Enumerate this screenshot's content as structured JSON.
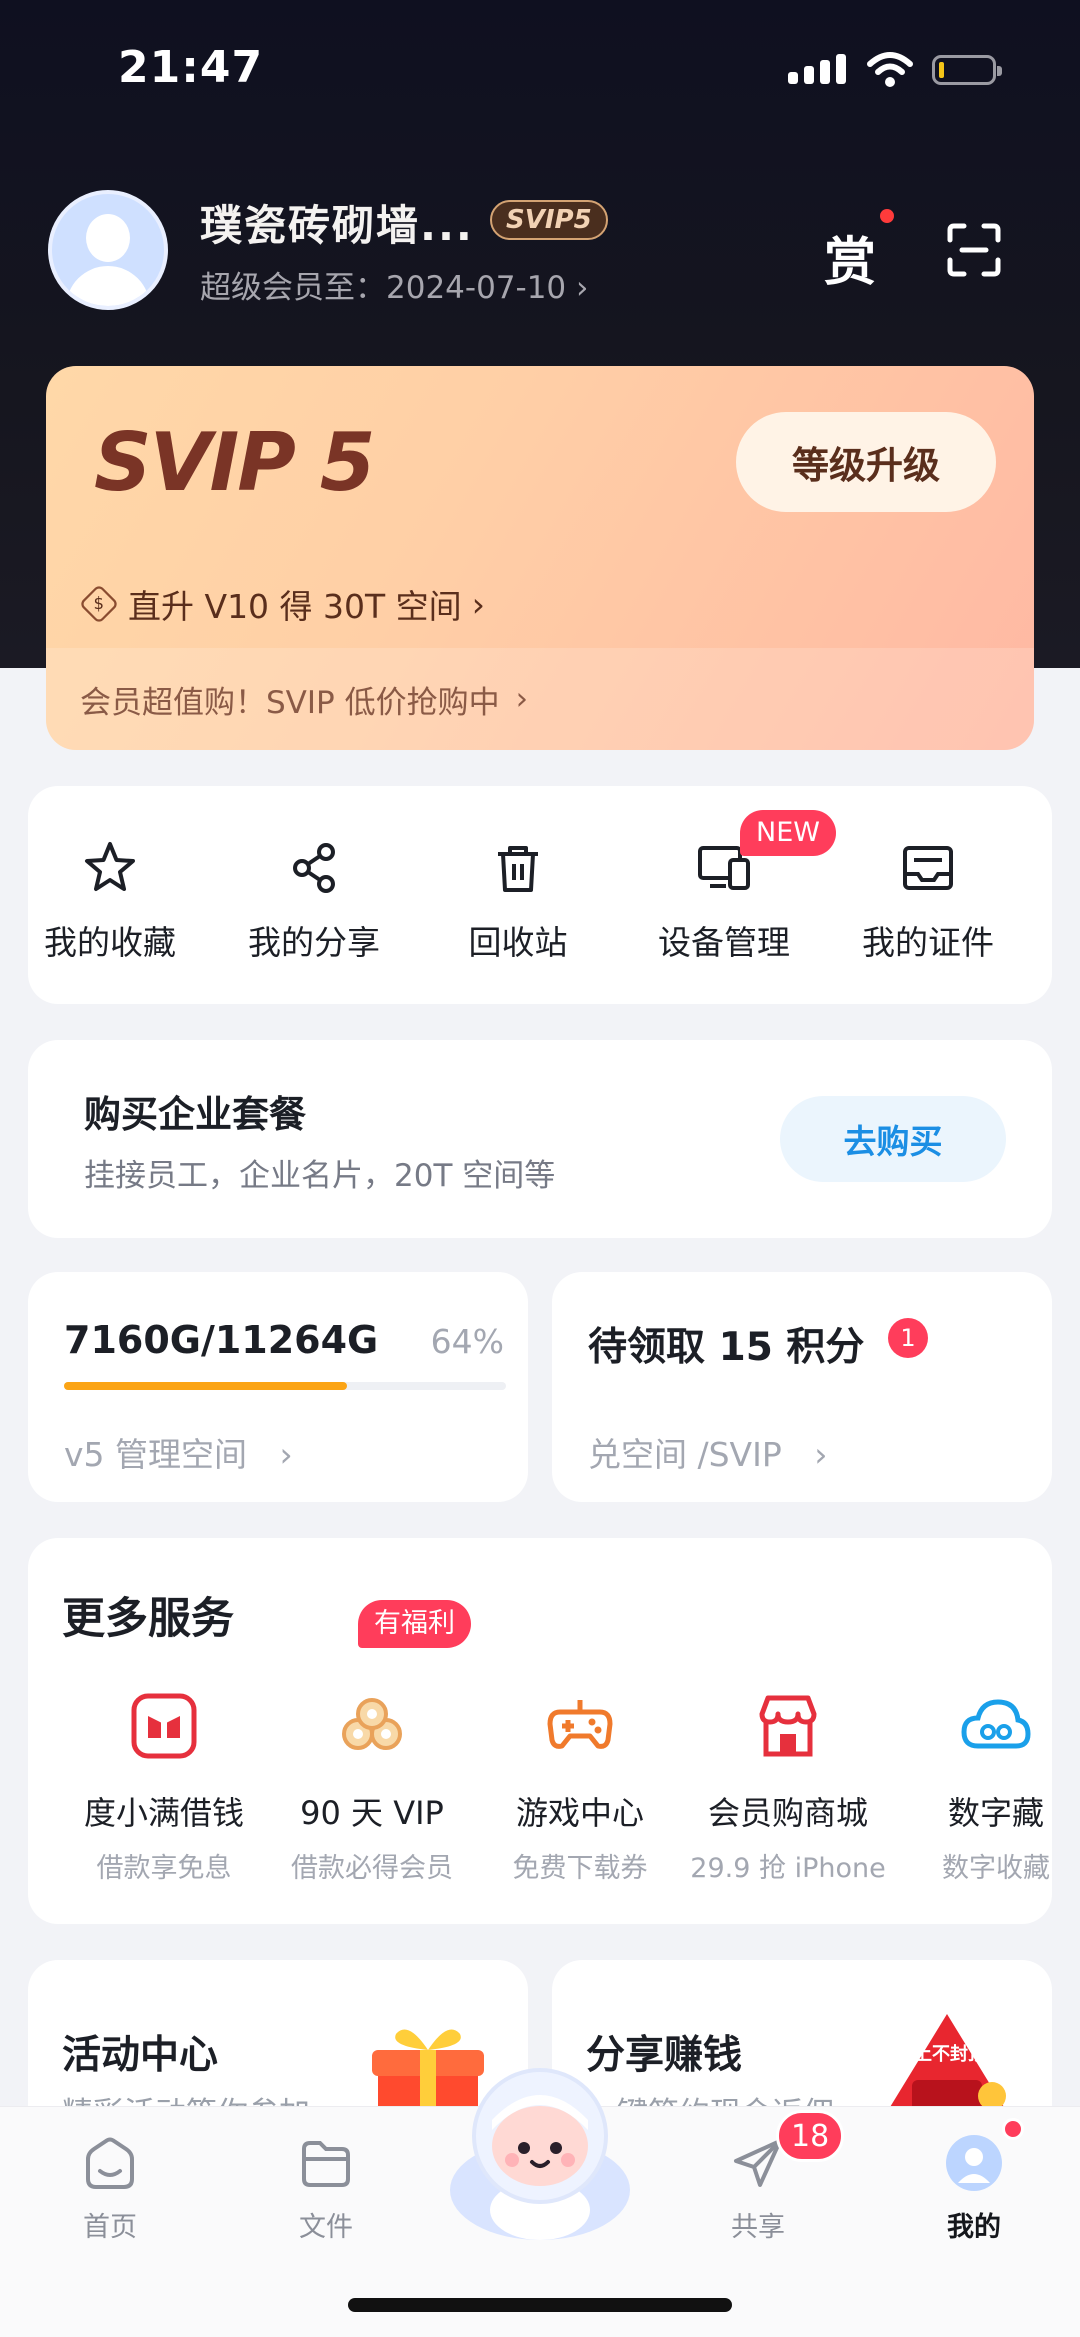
{
  "status_bar": {
    "time": "21:47"
  },
  "profile": {
    "username": "璞瓷砖砌墙...",
    "badge": "SVIP5",
    "expiry": "超级会员至：2024-07-10",
    "chevron": "›"
  },
  "header_icons": {
    "reward_label": "赏"
  },
  "vip_card": {
    "level": "SVIP 5",
    "upgrade_button": "等级升级",
    "promo_icon": "$",
    "promo_text": "直升 V10 得 30T 空间",
    "deal_text": "会员超值购！SVIP 低价抢购中",
    "chevron": "›"
  },
  "quick_actions": [
    {
      "label": "我的收藏",
      "icon": "star-icon"
    },
    {
      "label": "我的分享",
      "icon": "share-icon"
    },
    {
      "label": "回收站",
      "icon": "trash-icon"
    },
    {
      "label": "设备管理",
      "icon": "device-icon"
    },
    {
      "label": "我的证件",
      "icon": "id-card-icon"
    }
  ],
  "new_badge": "NEW",
  "enterprise": {
    "title": "购买企业套餐",
    "subtitle": "挂接员工，企业名片，20T 空间等",
    "button": "去购买"
  },
  "storage": {
    "usage": "7160G/11264G",
    "percent_text": "64%",
    "percent": 64,
    "link": "v5 管理空间",
    "chevron": "›"
  },
  "points": {
    "title": "待领取 15 积分",
    "badge": "1",
    "link": "兑空间 /SVIP",
    "chevron": "›"
  },
  "more_services": {
    "title": "更多服务",
    "badge": "有福利",
    "items": [
      {
        "name": "度小满借钱",
        "desc": "借款享免息",
        "icon": "wallet-icon"
      },
      {
        "name": "90 天 VIP",
        "desc": "借款必得会员",
        "icon": "coins-icon"
      },
      {
        "name": "游戏中心",
        "desc": "免费下载券",
        "icon": "gamepad-icon"
      },
      {
        "name": "会员购商城",
        "desc": "29.9 抢 iPhone",
        "icon": "store-icon"
      },
      {
        "name": "数字藏",
        "desc": "数字收藏",
        "icon": "cloud-icon"
      }
    ]
  },
  "activity": {
    "title": "活动中心",
    "subtitle": "精彩活动等你参加"
  },
  "share_earn": {
    "title": "分享赚钱",
    "subtitle": "一键答约现金返佣",
    "banner": "上不封顶"
  },
  "tabbar": {
    "tabs": [
      {
        "label": "首页",
        "icon": "home-icon"
      },
      {
        "label": "文件",
        "icon": "folder-icon"
      },
      {
        "label": "共享",
        "icon": "send-icon"
      },
      {
        "label": "我的",
        "icon": "avatar-icon"
      }
    ],
    "share_badge": "18"
  },
  "colors": {
    "accent": "#1b8ee4",
    "badge": "#ff3d5b",
    "progress": "#fba415",
    "vip_text": "#7a3426"
  }
}
